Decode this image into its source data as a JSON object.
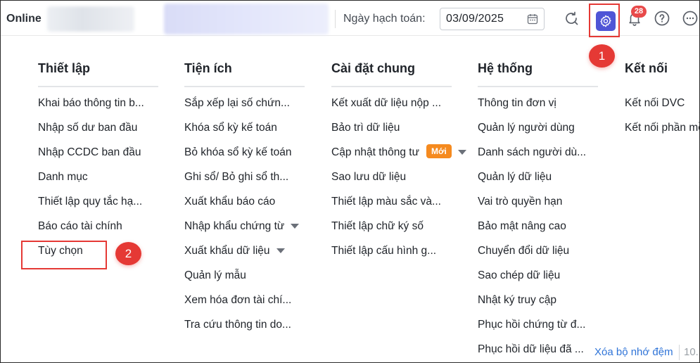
{
  "topbar": {
    "brand": "Online",
    "date_label": "Ngày hạch toán:",
    "date_value": "03/09/2025",
    "notification_count": "28"
  },
  "annotations": {
    "step1": "1",
    "step2": "2"
  },
  "menu": {
    "columns": [
      {
        "title": "Thiết lập",
        "items": [
          {
            "label": "Khai báo thông tin b..."
          },
          {
            "label": "Nhập số dư ban đầu"
          },
          {
            "label": "Nhập CCDC ban đầu"
          },
          {
            "label": "Danh mục"
          },
          {
            "label": "Thiết lập quy tắc hạ..."
          },
          {
            "label": "Báo cáo tài chính"
          },
          {
            "label": "Tùy chọn"
          }
        ]
      },
      {
        "title": "Tiện ích",
        "items": [
          {
            "label": "Sắp xếp lại số chứn..."
          },
          {
            "label": "Khóa sổ kỳ kế toán"
          },
          {
            "label": "Bỏ khóa sổ kỳ kế toán"
          },
          {
            "label": "Ghi sổ/ Bỏ ghi sổ th..."
          },
          {
            "label": "Xuất khẩu báo cáo"
          },
          {
            "label": "Nhập khẩu chứng từ"
          },
          {
            "label": "Xuất khẩu dữ liệu"
          },
          {
            "label": "Quản lý mẫu"
          },
          {
            "label": "Xem hóa đơn tài chí..."
          },
          {
            "label": "Tra cứu thông tin do..."
          }
        ]
      },
      {
        "title": "Cài đặt chung",
        "items": [
          {
            "label": "Kết xuất dữ liệu nộp ..."
          },
          {
            "label": "Bảo trì dữ liệu"
          },
          {
            "label": "Cập nhật thông tư",
            "badge": "Mới"
          },
          {
            "label": "Sao lưu dữ liệu"
          },
          {
            "label": "Thiết lập màu sắc và..."
          },
          {
            "label": "Thiết lập chữ ký số"
          },
          {
            "label": "Thiết lập cấu hình g..."
          }
        ]
      },
      {
        "title": "Hệ thống",
        "items": [
          {
            "label": "Thông tin đơn vị"
          },
          {
            "label": "Quản lý người dùng"
          },
          {
            "label": "Danh sách người dù..."
          },
          {
            "label": "Quản lý dữ liệu"
          },
          {
            "label": "Vai trò quyền hạn"
          },
          {
            "label": "Bảo mật nâng cao"
          },
          {
            "label": "Chuyển đổi dữ liệu"
          },
          {
            "label": "Sao chép dữ liệu"
          },
          {
            "label": "Nhật ký truy cập"
          },
          {
            "label": "Phục hồi chứng từ đ..."
          },
          {
            "label": "Phục hồi dữ liệu đã ..."
          }
        ]
      },
      {
        "title": "Kết nối",
        "items": [
          {
            "label": "Kết nối DVC"
          },
          {
            "label": "Kết nối phần mề"
          }
        ]
      }
    ]
  },
  "footer": {
    "clear_cache": "Xóa bộ nhớ đệm",
    "version": "10."
  },
  "colors": {
    "accent": "#4f55d6",
    "annotation": "#e53935",
    "new_badge": "#f58a1f",
    "link": "#2f74d8"
  }
}
